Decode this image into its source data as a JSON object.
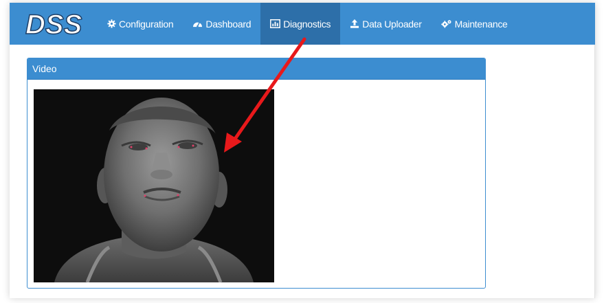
{
  "app": {
    "logo_text": "DSS"
  },
  "nav": {
    "items": [
      {
        "label": "Configuration",
        "icon": "gear-icon",
        "active": false
      },
      {
        "label": "Dashboard",
        "icon": "dashboard-gauge-icon",
        "active": false
      },
      {
        "label": "Diagnostics",
        "icon": "chart-icon",
        "active": true
      },
      {
        "label": "Data Uploader",
        "icon": "upload-icon",
        "active": false
      },
      {
        "label": "Maintenance",
        "icon": "gears-icon",
        "active": false
      }
    ]
  },
  "panel": {
    "title": "Video"
  },
  "colors": {
    "navbar": "#3c8dd0",
    "nav_active": "#2d6fa9",
    "panel_border": "#3c8dd0",
    "annotation_arrow": "#e8191b",
    "landmark_dots": "#e0406a"
  }
}
